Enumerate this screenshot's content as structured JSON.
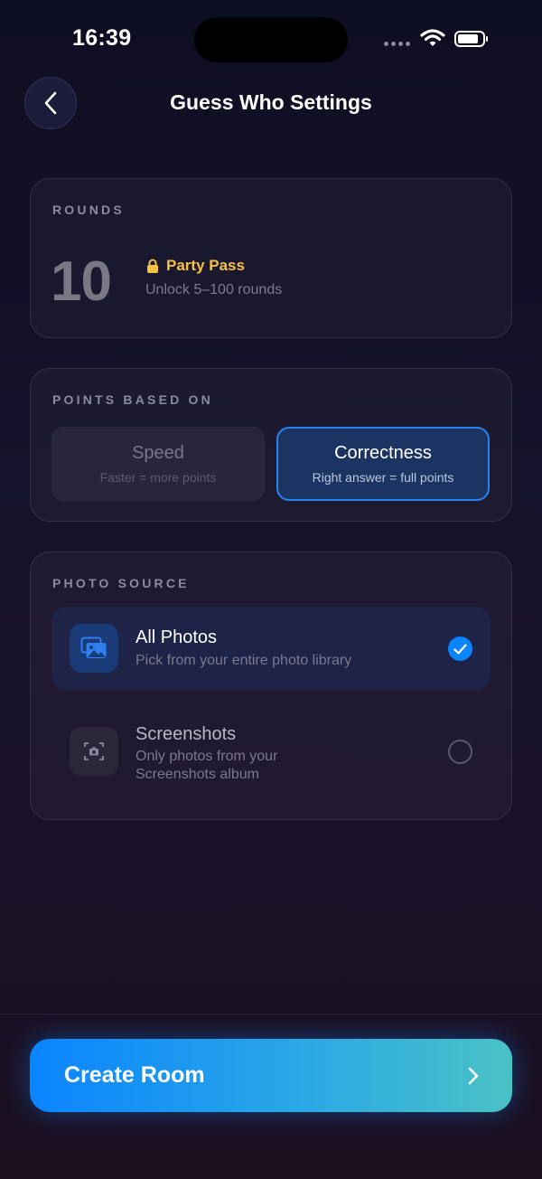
{
  "status_bar": {
    "time": "16:39",
    "battery_level": 0.85
  },
  "header": {
    "title": "Guess Who Settings"
  },
  "rounds": {
    "label": "ROUNDS",
    "value": "10",
    "pass_label": "Party Pass",
    "pass_subtitle": "Unlock 5–100 rounds"
  },
  "points": {
    "label": "POINTS BASED ON",
    "options": [
      {
        "title": "Speed",
        "subtitle": "Faster = more points",
        "selected": false
      },
      {
        "title": "Correctness",
        "subtitle": "Right answer = full points",
        "selected": true
      }
    ]
  },
  "photo_source": {
    "label": "PHOTO SOURCE",
    "options": [
      {
        "title": "All Photos",
        "subtitle": "Pick from your entire photo library",
        "selected": true,
        "icon": "photos-icon"
      },
      {
        "title": "Screenshots",
        "subtitle": "Only photos from your Screenshots album",
        "selected": false,
        "icon": "screenshot-icon"
      }
    ]
  },
  "footer": {
    "create_label": "Create Room"
  },
  "colors": {
    "accent": "#0a84ff",
    "gold": "#f6c143",
    "selected_bg": "#1c3462",
    "button_gradient_end": "#49c2c6"
  }
}
